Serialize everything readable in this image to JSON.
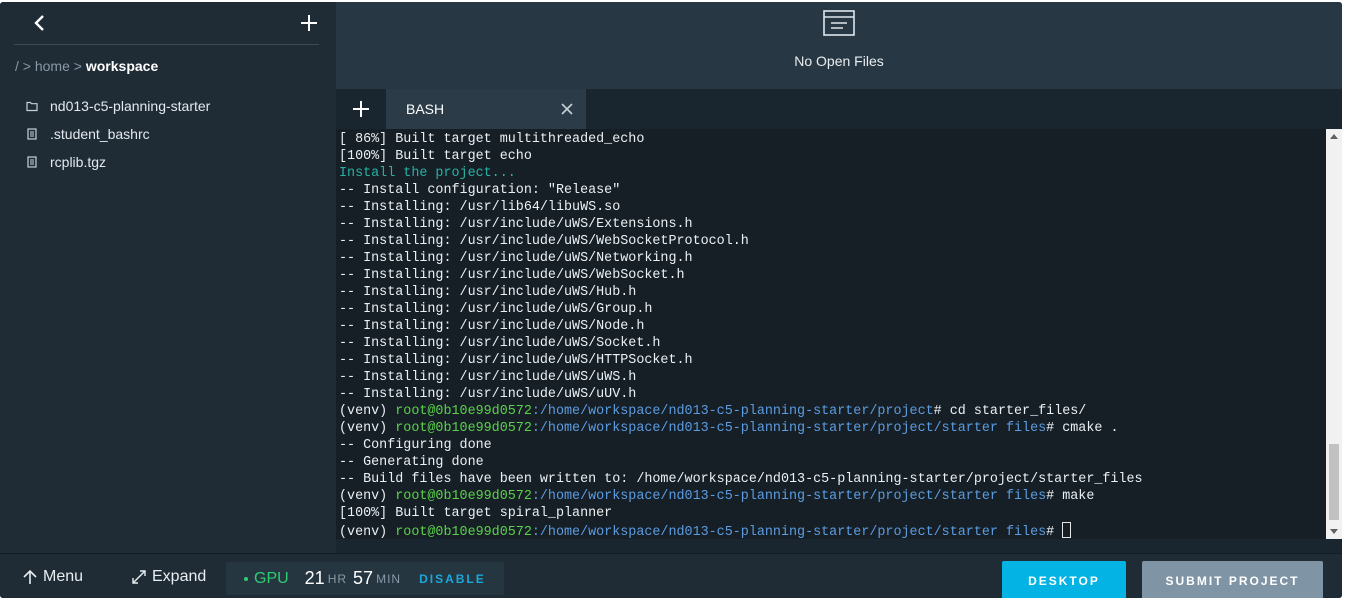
{
  "sidebar": {
    "breadcrumb": {
      "root": "/",
      "sep": ">",
      "home": "home",
      "current": "workspace"
    },
    "files": [
      {
        "name": "nd013-c5-planning-starter",
        "icon": "folder-icon"
      },
      {
        "name": ".student_bashrc",
        "icon": "file-icon"
      },
      {
        "name": "rcplib.tgz",
        "icon": "file-icon"
      }
    ]
  },
  "editor": {
    "empty_message": "No Open Files"
  },
  "tabs": [
    {
      "label": "BASH"
    }
  ],
  "terminal": {
    "lines": [
      {
        "type": "plain",
        "text": "[ 86%] Built target multithreaded_echo"
      },
      {
        "type": "plain",
        "text": "[100%] Built target echo"
      },
      {
        "type": "cyan",
        "text": "Install the project..."
      },
      {
        "type": "plain",
        "text": "-- Install configuration: \"Release\""
      },
      {
        "type": "plain",
        "text": "-- Installing: /usr/lib64/libuWS.so"
      },
      {
        "type": "plain",
        "text": "-- Installing: /usr/include/uWS/Extensions.h"
      },
      {
        "type": "plain",
        "text": "-- Installing: /usr/include/uWS/WebSocketProtocol.h"
      },
      {
        "type": "plain",
        "text": "-- Installing: /usr/include/uWS/Networking.h"
      },
      {
        "type": "plain",
        "text": "-- Installing: /usr/include/uWS/WebSocket.h"
      },
      {
        "type": "plain",
        "text": "-- Installing: /usr/include/uWS/Hub.h"
      },
      {
        "type": "plain",
        "text": "-- Installing: /usr/include/uWS/Group.h"
      },
      {
        "type": "plain",
        "text": "-- Installing: /usr/include/uWS/Node.h"
      },
      {
        "type": "plain",
        "text": "-- Installing: /usr/include/uWS/Socket.h"
      },
      {
        "type": "plain",
        "text": "-- Installing: /usr/include/uWS/HTTPSocket.h"
      },
      {
        "type": "plain",
        "text": "-- Installing: /usr/include/uWS/uWS.h"
      },
      {
        "type": "plain",
        "text": "-- Installing: /usr/include/uWS/uUV.h"
      },
      {
        "type": "prompt",
        "env": "(venv) ",
        "user": "root@0b10e99d0572",
        "path": ":/home/workspace/nd013-c5-planning-starter/project",
        "cmd": "# cd starter_files/"
      },
      {
        "type": "prompt",
        "env": "(venv) ",
        "user": "root@0b10e99d0572",
        "path": ":/home/workspace/nd013-c5-planning-starter/project/starter files",
        "cmd": "# cmake ."
      },
      {
        "type": "plain",
        "text": "-- Configuring done"
      },
      {
        "type": "plain",
        "text": "-- Generating done"
      },
      {
        "type": "plain",
        "text": "-- Build files have been written to: /home/workspace/nd013-c5-planning-starter/project/starter_files"
      },
      {
        "type": "prompt",
        "env": "(venv) ",
        "user": "root@0b10e99d0572",
        "path": ":/home/workspace/nd013-c5-planning-starter/project/starter files",
        "cmd": "# make"
      },
      {
        "type": "plain",
        "text": "[100%] Built target spiral_planner"
      },
      {
        "type": "prompt",
        "env": "(venv) ",
        "user": "root@0b10e99d0572",
        "path": ":/home/workspace/nd013-c5-planning-starter/project/starter files",
        "cmd": "# ",
        "cursor": true
      }
    ]
  },
  "bottom": {
    "menu_label": "Menu",
    "expand_label": "Expand",
    "gpu_label": "GPU",
    "hours": "21",
    "hours_unit": "HR",
    "minutes": "57",
    "minutes_unit": "MIN",
    "disable_label": "DISABLE",
    "desktop_label": "DESKTOP",
    "submit_label": "SUBMIT PROJECT"
  },
  "colors": {
    "accent": "#02b3e4",
    "gpu_green": "#2ecc71",
    "prompt_user": "#5bd24a",
    "prompt_path": "#5c9ce0",
    "install_cyan": "#27b2a6"
  }
}
